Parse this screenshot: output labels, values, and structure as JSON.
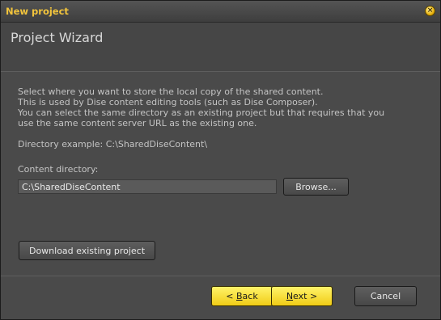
{
  "window": {
    "title": "New project",
    "close_icon": "close-icon"
  },
  "header": {
    "title": "Project Wizard"
  },
  "description": {
    "lines": [
      "Select where you want to store the local copy of the shared content.",
      "This is used by Dise content editing tools (such as Dise Composer).",
      "You can select the same directory as an existing project but that requires that you",
      "use the same content server URL as the existing one."
    ]
  },
  "example": {
    "text": "Directory example: C:\\SharedDiseContent\\"
  },
  "content_dir": {
    "label": "Content directory:",
    "value": "C:\\SharedDiseContent",
    "browse_label": "Browse..."
  },
  "download_label": "Download existing project",
  "footer": {
    "back_prefix": "< ",
    "back_mnemonic": "B",
    "back_rest": "ack",
    "next_mnemonic": "N",
    "next_rest": "ext >",
    "cancel_label": "Cancel"
  },
  "colors": {
    "title_accent": "#f2c43c",
    "primary_button": "#f5da2c"
  }
}
